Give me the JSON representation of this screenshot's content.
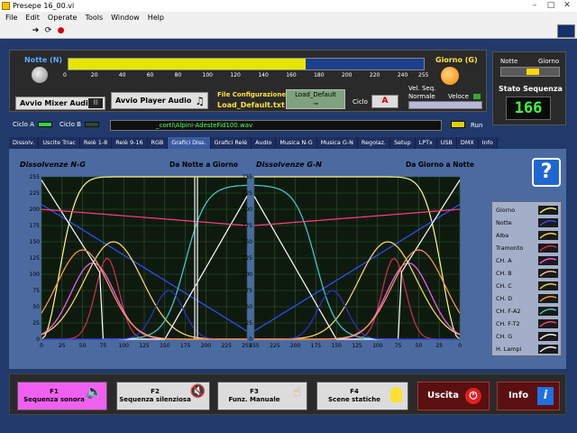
{
  "window": {
    "title": "Presepe 16_00.vi",
    "min": "–",
    "max": "□",
    "close": "✕"
  },
  "menu": [
    "File",
    "Edit",
    "Operate",
    "Tools",
    "Window",
    "Help"
  ],
  "top": {
    "notte_label": "Notte (N)",
    "giorno_label": "Giorno (G)",
    "slider_ticks": [
      "0",
      "20",
      "40",
      "60",
      "80",
      "100",
      "120",
      "140",
      "160",
      "180",
      "200",
      "220",
      "240",
      "255"
    ],
    "slider_value": 170,
    "avvio_mixer": "Avvio  Mixer Audio",
    "avvio_player": "Avvio  Player Audio",
    "file_config_label": "File Configurazione",
    "file_config_value": "Load_Default.txt",
    "load_default": "Load_Default",
    "ciclo_label": "Ciclo",
    "ciclo_value": "A",
    "vel_seq_label": "Vel. Seq.",
    "vel_normale": "Normale",
    "vel_veloce": "Veloce"
  },
  "right": {
    "notte": "Notte",
    "giorno": "Giorno",
    "stato_label": "Stato Sequenza",
    "stato_value": "166"
  },
  "row2": {
    "ciclo_a": "Ciclo A",
    "ciclo_b": "Ciclo B",
    "path": "_corti\\Alpini-AdesteFid100.wav",
    "run": "Run"
  },
  "tabs": [
    "Dissolv.",
    "Uscite Triac",
    "Relè 1-8",
    "Relè 9-16",
    "RGB",
    "Grafici Diss.",
    "Grafici Relè",
    "Audio",
    "Musica N-G",
    "Musica G-N",
    "Regolaz.",
    "Setup",
    "LPTx",
    "USB",
    "DMX",
    "Info"
  ],
  "active_tab": 5,
  "charts": {
    "left_title": "Dissolvenze N-G",
    "left_sub": "Da Notte a Giorno",
    "right_title": "Dissolvenze G-N",
    "right_sub": "Da Giorno a Notte",
    "y_ticks": [
      "255",
      "225",
      "200",
      "175",
      "150",
      "125",
      "100",
      "75",
      "50",
      "25",
      "0"
    ],
    "left_x_ticks": [
      "0",
      "25",
      "50",
      "75",
      "100",
      "125",
      "150",
      "175",
      "200",
      "225",
      "255"
    ],
    "right_x_ticks": [
      "255",
      "225",
      "200",
      "175",
      "150",
      "125",
      "100",
      "75",
      "50",
      "25",
      "0"
    ]
  },
  "legend": [
    {
      "name": "Giorno",
      "color": "#ffff80"
    },
    {
      "name": "Notte",
      "color": "#3050ff"
    },
    {
      "name": "Alba",
      "color": "#ffe060"
    },
    {
      "name": "Tramonto",
      "color": "#d03050"
    },
    {
      "name": "CH. A",
      "color": "#ff60ff"
    },
    {
      "name": "CH. B",
      "color": "#ffc8a0"
    },
    {
      "name": "CH. C",
      "color": "#e8e060"
    },
    {
      "name": "CH. D",
      "color": "#ffa040"
    },
    {
      "name": "CH. F-A2",
      "color": "#40d0d0"
    },
    {
      "name": "CH. F-T2",
      "color": "#ff4080"
    },
    {
      "name": "CH. G",
      "color": "#ffffff"
    },
    {
      "name": "H. Lampi",
      "color": "#ffffff"
    }
  ],
  "footer": {
    "f1_key": "F1",
    "f1_label": "Sequenza sonora",
    "f2_key": "F2",
    "f2_label": "Sequenza silenziosa",
    "f3_key": "F3",
    "f3_label": "Funz. Manuale",
    "f4_key": "F4",
    "f4_label": "Scene statiche",
    "uscita": "Uscita",
    "info": "Info"
  }
}
